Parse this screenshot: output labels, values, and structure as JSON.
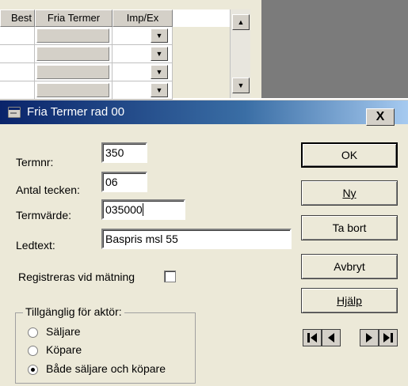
{
  "grid": {
    "columns": [
      "Best",
      "Fria Termer",
      "Imp/Ex"
    ],
    "row_count": 4
  },
  "dialog": {
    "title": "Fria Termer rad 00",
    "close_label": "X",
    "fields": {
      "termnr": {
        "label": "Termnr:",
        "value": "350"
      },
      "antal": {
        "label": "Antal tecken:",
        "value": "06"
      },
      "termvarde": {
        "label": "Termvärde:",
        "value": "035000"
      },
      "ledtext": {
        "label": "Ledtext:",
        "value": "Baspris msl 55"
      }
    },
    "checkbox": {
      "label": "Registreras vid mätning",
      "checked": false
    },
    "group": {
      "title": "Tillgänglig för aktör:",
      "options": [
        "Säljare",
        "Köpare",
        "Både säljare och köpare"
      ],
      "selected": 2
    },
    "buttons": {
      "ok": "OK",
      "ny": "Ny",
      "ta_bort": "Ta bort",
      "avbryt": "Avbryt",
      "hjalp": "Hjälp"
    }
  },
  "icons": {
    "dialog": "window-icon",
    "first": "first-record-icon",
    "prev": "previous-record-icon",
    "next": "next-record-icon",
    "last": "last-record-icon"
  }
}
